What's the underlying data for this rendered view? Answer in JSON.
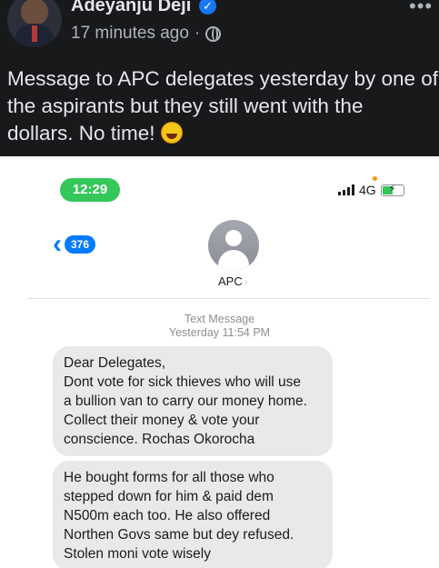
{
  "post": {
    "author_name": "Adeyanju Deji",
    "timestamp": "17 minutes ago",
    "separator": "·",
    "text": "Message to APC delegates yesterday by one of\nthe aspirants but they still went with the\ndollars. No time!",
    "icons": {
      "verified": "verified-badge-icon",
      "privacy": "globe-icon",
      "more": "more-options-icon",
      "emoji": "rolling-on-floor-laughing-icon"
    }
  },
  "screenshot": {
    "status_bar": {
      "time": "12:29",
      "network": "4G"
    },
    "nav": {
      "back_badge": "376",
      "contact_name": "APC"
    },
    "conversation": {
      "type_label": "Text Message",
      "day_time": "Yesterday 11:54 PM"
    },
    "messages": [
      "Dear Delegates,\nDont vote for sick thieves who will use\na bullion van to carry our money home.\nCollect their money & vote your\nconscience. Rochas Okorocha",
      "He bought forms for all those who\nstepped down for him & paid dem\nN500m each too. He also offered\nNorthen Govs same but dey refused.\nStolen moni vote wisely"
    ]
  },
  "colors": {
    "background": "#18191a",
    "imessage_blue": "#007aff",
    "status_green": "#34c759",
    "bubble_gray": "#e9e9eb"
  }
}
